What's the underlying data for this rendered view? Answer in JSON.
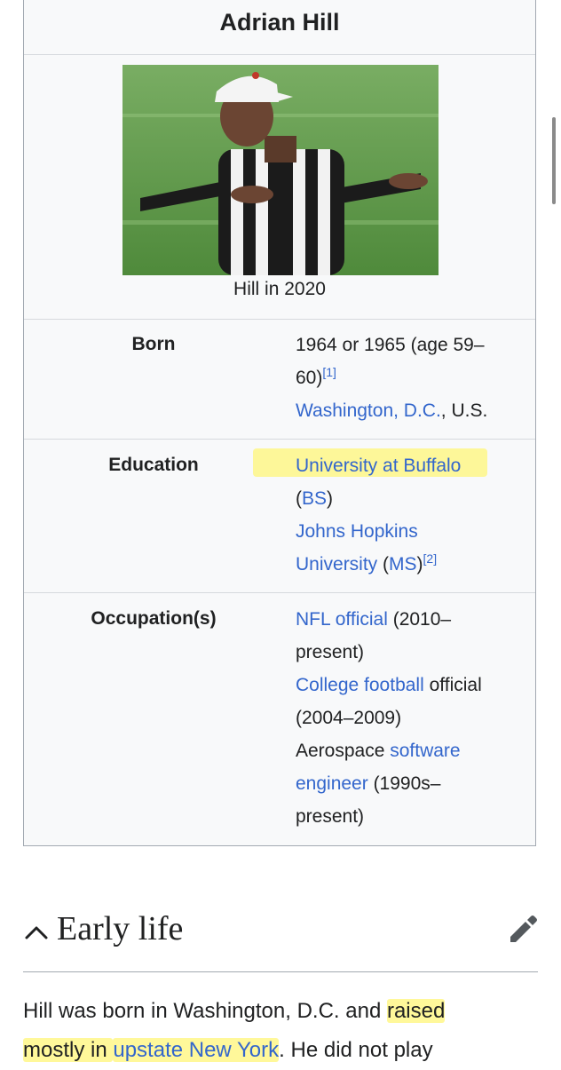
{
  "infobox": {
    "title": "Adrian Hill",
    "caption": "Hill in 2020",
    "rows": {
      "born": {
        "label": "Born",
        "text1": "1964 or 1965 (age 59–",
        "text2": "60)",
        "ref": "[1]",
        "place_link": "Washington, D.C.",
        "place_rest": ", U.S."
      },
      "education": {
        "label": "Education",
        "link1": "University at Buffalo",
        "paren_open": "(",
        "link2": "BS",
        "paren_close": ")",
        "link3_line1": "Johns Hopkins",
        "link3_line2": "University",
        "space": " (",
        "link4": "MS",
        "close": ")",
        "ref": "[2]"
      },
      "occupation": {
        "label": "Occupation(s)",
        "l1_link": "NFL official",
        "l1_rest": " (2010–",
        "l2": "present)",
        "l3_link": "College football",
        "l3_rest": " official",
        "l4": "(2004–2009)",
        "l5_text": "Aerospace ",
        "l5_link": "software",
        "l6_link": "engineer",
        "l6_rest": " (1990s–",
        "l7": "present)"
      }
    }
  },
  "section": {
    "title": "Early life",
    "collapse_icon": "chevron-up-icon",
    "edit_icon": "pencil-icon"
  },
  "paragraph": {
    "t1": "Hill was born in Washington, D.C. and ",
    "t2": "raised",
    "t3": "mostly in ",
    "link": "upstate New York",
    "t4": ". He did not play"
  },
  "colors": {
    "link": "#3366cc",
    "highlight": "#fff678",
    "infobox_bg": "#f8f9fa"
  }
}
